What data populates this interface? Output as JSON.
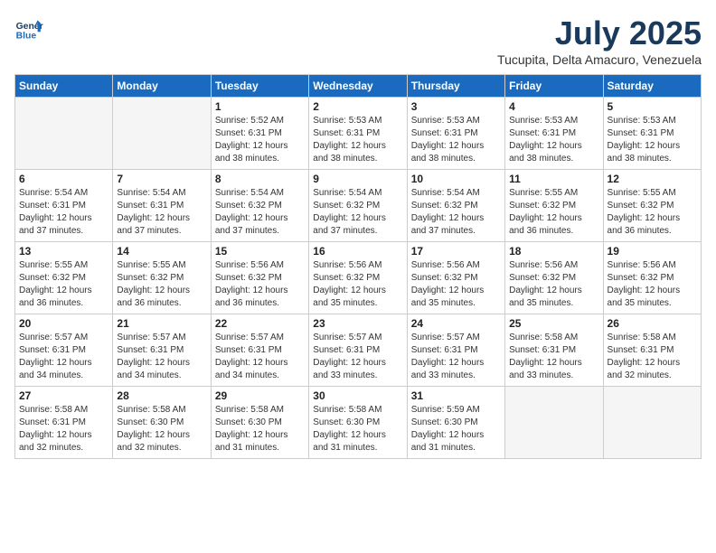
{
  "logo": {
    "line1": "General",
    "line2": "Blue"
  },
  "title": "July 2025",
  "subtitle": "Tucupita, Delta Amacuro, Venezuela",
  "weekdays": [
    "Sunday",
    "Monday",
    "Tuesday",
    "Wednesday",
    "Thursday",
    "Friday",
    "Saturday"
  ],
  "weeks": [
    [
      {
        "day": "",
        "info": ""
      },
      {
        "day": "",
        "info": ""
      },
      {
        "day": "1",
        "info": "Sunrise: 5:52 AM\nSunset: 6:31 PM\nDaylight: 12 hours\nand 38 minutes."
      },
      {
        "day": "2",
        "info": "Sunrise: 5:53 AM\nSunset: 6:31 PM\nDaylight: 12 hours\nand 38 minutes."
      },
      {
        "day": "3",
        "info": "Sunrise: 5:53 AM\nSunset: 6:31 PM\nDaylight: 12 hours\nand 38 minutes."
      },
      {
        "day": "4",
        "info": "Sunrise: 5:53 AM\nSunset: 6:31 PM\nDaylight: 12 hours\nand 38 minutes."
      },
      {
        "day": "5",
        "info": "Sunrise: 5:53 AM\nSunset: 6:31 PM\nDaylight: 12 hours\nand 38 minutes."
      }
    ],
    [
      {
        "day": "6",
        "info": "Sunrise: 5:54 AM\nSunset: 6:31 PM\nDaylight: 12 hours\nand 37 minutes."
      },
      {
        "day": "7",
        "info": "Sunrise: 5:54 AM\nSunset: 6:31 PM\nDaylight: 12 hours\nand 37 minutes."
      },
      {
        "day": "8",
        "info": "Sunrise: 5:54 AM\nSunset: 6:32 PM\nDaylight: 12 hours\nand 37 minutes."
      },
      {
        "day": "9",
        "info": "Sunrise: 5:54 AM\nSunset: 6:32 PM\nDaylight: 12 hours\nand 37 minutes."
      },
      {
        "day": "10",
        "info": "Sunrise: 5:54 AM\nSunset: 6:32 PM\nDaylight: 12 hours\nand 37 minutes."
      },
      {
        "day": "11",
        "info": "Sunrise: 5:55 AM\nSunset: 6:32 PM\nDaylight: 12 hours\nand 36 minutes."
      },
      {
        "day": "12",
        "info": "Sunrise: 5:55 AM\nSunset: 6:32 PM\nDaylight: 12 hours\nand 36 minutes."
      }
    ],
    [
      {
        "day": "13",
        "info": "Sunrise: 5:55 AM\nSunset: 6:32 PM\nDaylight: 12 hours\nand 36 minutes."
      },
      {
        "day": "14",
        "info": "Sunrise: 5:55 AM\nSunset: 6:32 PM\nDaylight: 12 hours\nand 36 minutes."
      },
      {
        "day": "15",
        "info": "Sunrise: 5:56 AM\nSunset: 6:32 PM\nDaylight: 12 hours\nand 36 minutes."
      },
      {
        "day": "16",
        "info": "Sunrise: 5:56 AM\nSunset: 6:32 PM\nDaylight: 12 hours\nand 35 minutes."
      },
      {
        "day": "17",
        "info": "Sunrise: 5:56 AM\nSunset: 6:32 PM\nDaylight: 12 hours\nand 35 minutes."
      },
      {
        "day": "18",
        "info": "Sunrise: 5:56 AM\nSunset: 6:32 PM\nDaylight: 12 hours\nand 35 minutes."
      },
      {
        "day": "19",
        "info": "Sunrise: 5:56 AM\nSunset: 6:32 PM\nDaylight: 12 hours\nand 35 minutes."
      }
    ],
    [
      {
        "day": "20",
        "info": "Sunrise: 5:57 AM\nSunset: 6:31 PM\nDaylight: 12 hours\nand 34 minutes."
      },
      {
        "day": "21",
        "info": "Sunrise: 5:57 AM\nSunset: 6:31 PM\nDaylight: 12 hours\nand 34 minutes."
      },
      {
        "day": "22",
        "info": "Sunrise: 5:57 AM\nSunset: 6:31 PM\nDaylight: 12 hours\nand 34 minutes."
      },
      {
        "day": "23",
        "info": "Sunrise: 5:57 AM\nSunset: 6:31 PM\nDaylight: 12 hours\nand 33 minutes."
      },
      {
        "day": "24",
        "info": "Sunrise: 5:57 AM\nSunset: 6:31 PM\nDaylight: 12 hours\nand 33 minutes."
      },
      {
        "day": "25",
        "info": "Sunrise: 5:58 AM\nSunset: 6:31 PM\nDaylight: 12 hours\nand 33 minutes."
      },
      {
        "day": "26",
        "info": "Sunrise: 5:58 AM\nSunset: 6:31 PM\nDaylight: 12 hours\nand 32 minutes."
      }
    ],
    [
      {
        "day": "27",
        "info": "Sunrise: 5:58 AM\nSunset: 6:31 PM\nDaylight: 12 hours\nand 32 minutes."
      },
      {
        "day": "28",
        "info": "Sunrise: 5:58 AM\nSunset: 6:30 PM\nDaylight: 12 hours\nand 32 minutes."
      },
      {
        "day": "29",
        "info": "Sunrise: 5:58 AM\nSunset: 6:30 PM\nDaylight: 12 hours\nand 31 minutes."
      },
      {
        "day": "30",
        "info": "Sunrise: 5:58 AM\nSunset: 6:30 PM\nDaylight: 12 hours\nand 31 minutes."
      },
      {
        "day": "31",
        "info": "Sunrise: 5:59 AM\nSunset: 6:30 PM\nDaylight: 12 hours\nand 31 minutes."
      },
      {
        "day": "",
        "info": ""
      },
      {
        "day": "",
        "info": ""
      }
    ]
  ]
}
